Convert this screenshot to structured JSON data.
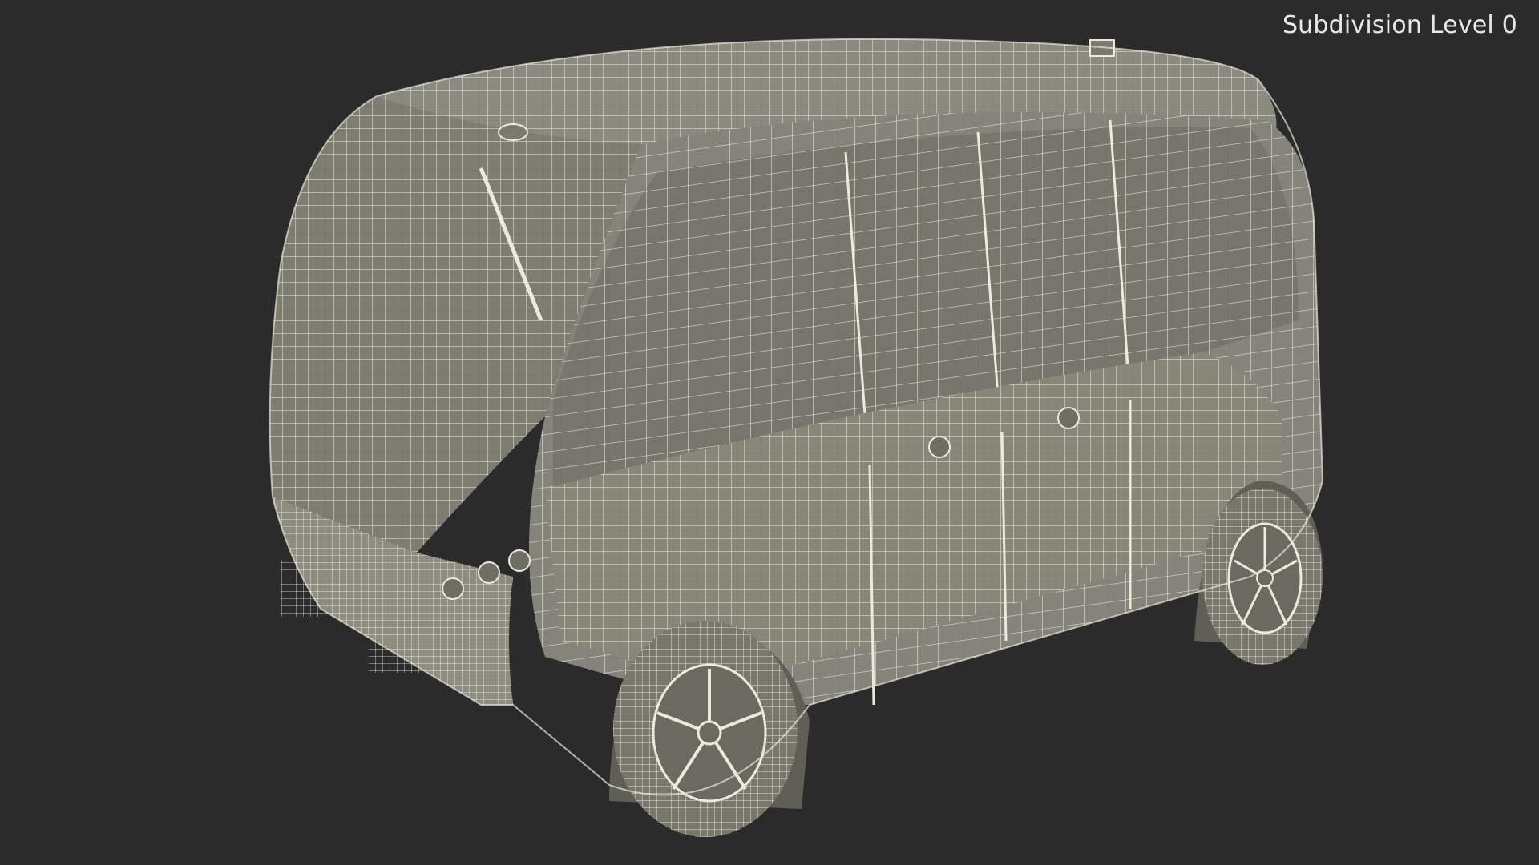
{
  "viewport": {
    "label": "Subdivision Level 0",
    "background": "#2b2b2b"
  },
  "model": {
    "subject": "autonomous shuttle van wireframe",
    "surface_color": "#7f7f74",
    "wire_color": "#eceadb",
    "icon": "wireframe-van"
  }
}
